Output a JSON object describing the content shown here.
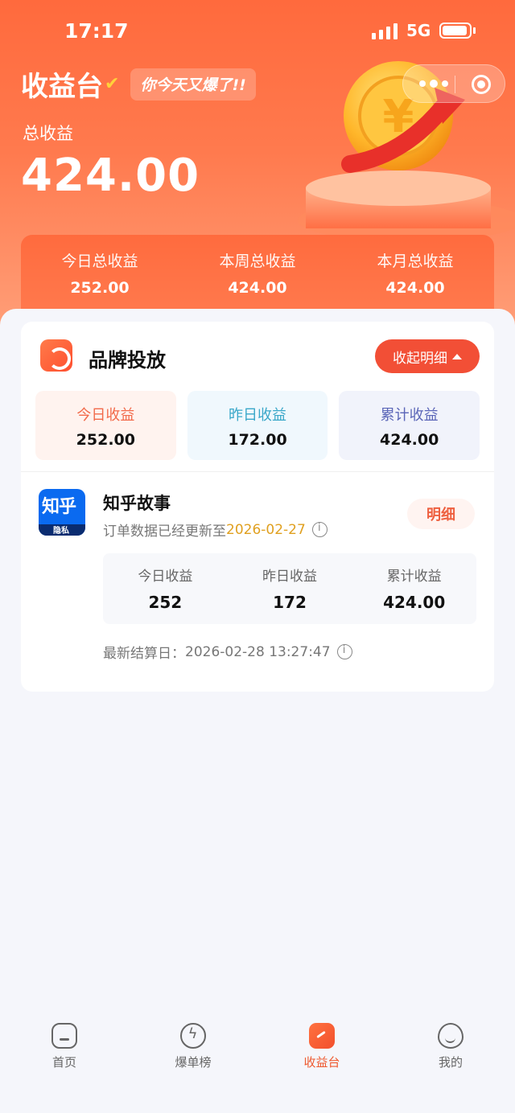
{
  "status_bar": {
    "time": "17:17",
    "network": "5G"
  },
  "header": {
    "title": "收益台",
    "slogan": "你今天又爆了!!",
    "total_label": "总收益",
    "total_value": "424.00"
  },
  "periods": [
    {
      "label": "今日总收益",
      "value": "252.00"
    },
    {
      "label": "本周总收益",
      "value": "424.00"
    },
    {
      "label": "本月总收益",
      "value": "424.00"
    }
  ],
  "brand": {
    "title": "品牌投放",
    "collapse_label": "收起明细",
    "summary": [
      {
        "label": "今日收益",
        "value": "252.00"
      },
      {
        "label": "昨日收益",
        "value": "172.00"
      },
      {
        "label": "累计收益",
        "value": "424.00"
      }
    ]
  },
  "app_item": {
    "icon_text_big": "知乎",
    "icon_text_small": "隐私",
    "name": "知乎故事",
    "update_prefix": "订单数据已经更新至",
    "update_date": "2026-02-27",
    "detail_label": "明细",
    "stats": [
      {
        "label": "今日收益",
        "value": "252"
      },
      {
        "label": "昨日收益",
        "value": "172"
      },
      {
        "label": "累计收益",
        "value": "424.00"
      }
    ],
    "settle_label": "最新结算日：",
    "settle_time": "2026-02-28 13:27:47"
  },
  "tabbar": [
    {
      "label": "首页",
      "icon": "home-icon"
    },
    {
      "label": "爆单榜",
      "icon": "lightning-icon"
    },
    {
      "label": "收益台",
      "icon": "earnings-icon"
    },
    {
      "label": "我的",
      "icon": "profile-icon"
    }
  ]
}
